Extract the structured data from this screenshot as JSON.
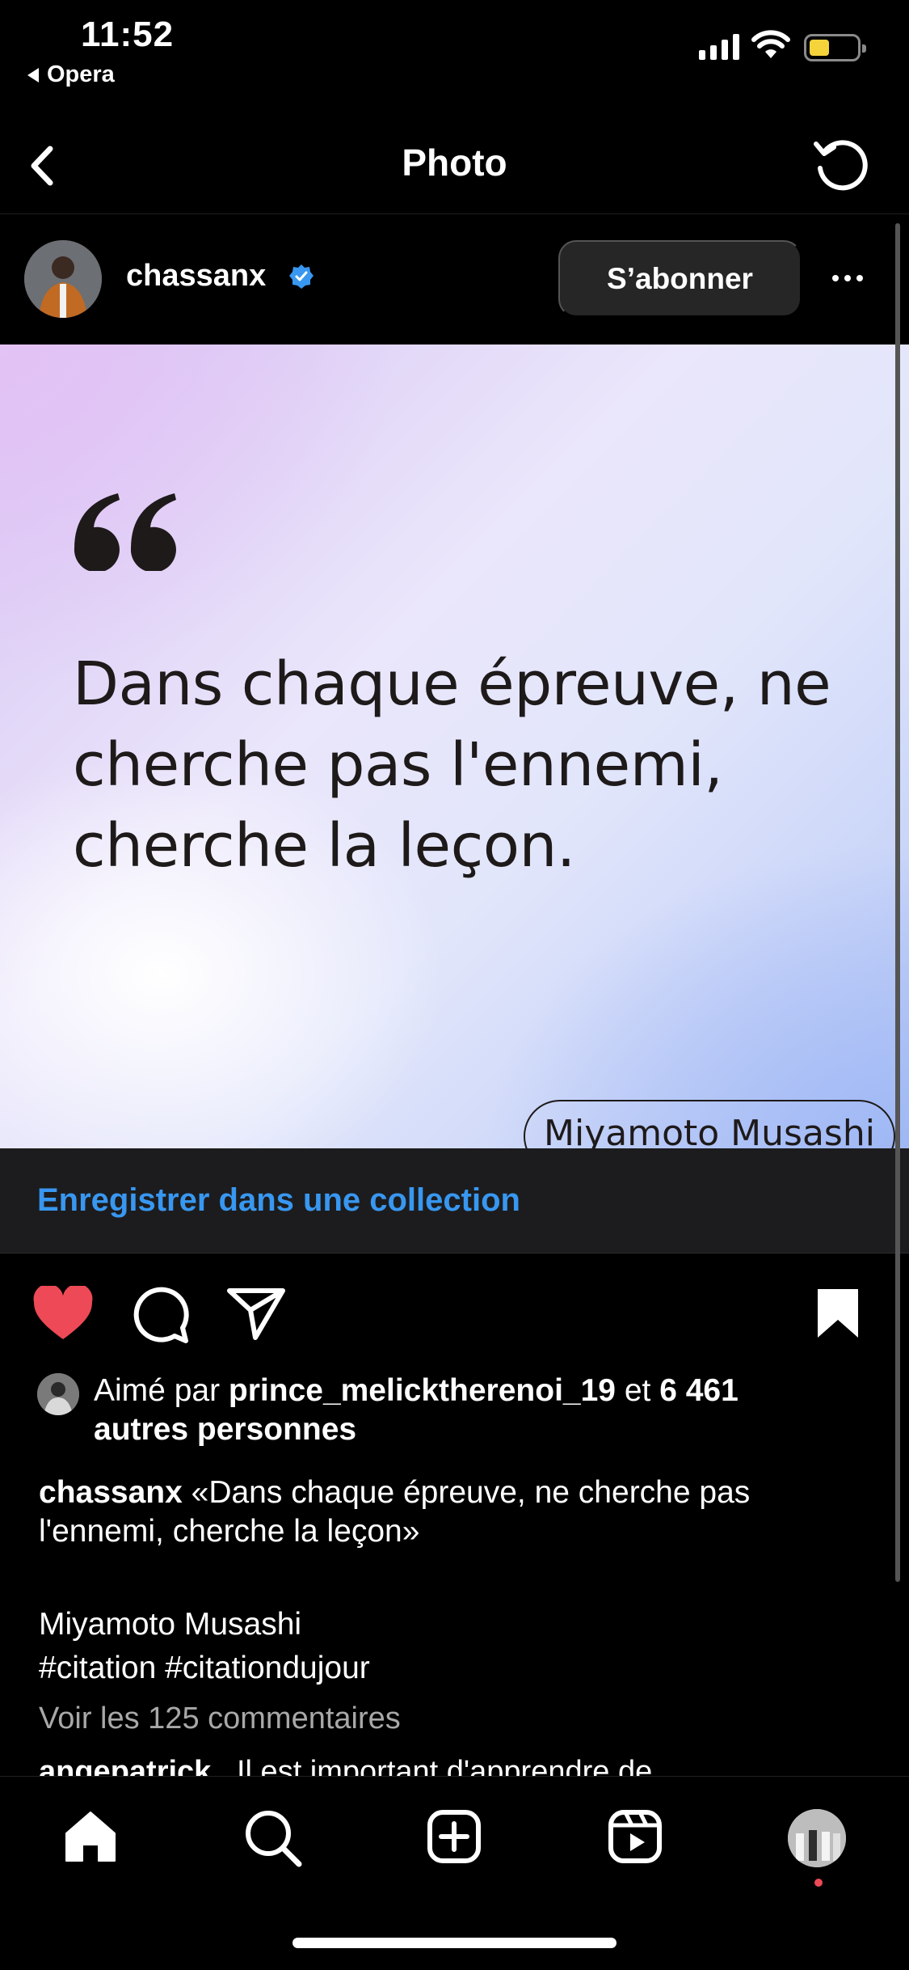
{
  "status_bar": {
    "time": "11:52",
    "back_app": "Opera"
  },
  "nav": {
    "title": "Photo"
  },
  "post": {
    "username": "chassanx",
    "follow_label": "S’abonner",
    "quote_lines": [
      "Dans chaque épreuve, ne",
      "cherche pas l'ennemi,",
      "cherche la leçon."
    ],
    "author_pill": "Miyamoto Musashi"
  },
  "collection": {
    "label": "Enregistrer dans une collection"
  },
  "likes": {
    "prefix": "Aimé par ",
    "user": "prince_melicktherenoi_19",
    "middle": " et ",
    "count": "6 461",
    "suffix": "autres personnes"
  },
  "caption": {
    "author": "chassanx",
    "text": " «Dans chaque épreuve, ne cherche pas l'ennemi, cherche la leçon»",
    "line2": "Miyamoto Musashi",
    "tags": "#citation #citationdujour"
  },
  "comments": {
    "view_all": "Voir les 125 commentaires",
    "peek_user": "angepatrick",
    "peek_text": "Il est important d'apprendre de"
  },
  "colors": {
    "accent": "#3897f0",
    "like": "#ed4956",
    "verified": "#3897f0"
  },
  "icons": [
    "back-chevron-icon",
    "reload-icon",
    "verified-icon",
    "more-icon",
    "heart-icon",
    "comment-icon",
    "share-icon",
    "bookmark-icon",
    "home-icon",
    "search-icon",
    "create-icon",
    "reels-icon"
  ]
}
